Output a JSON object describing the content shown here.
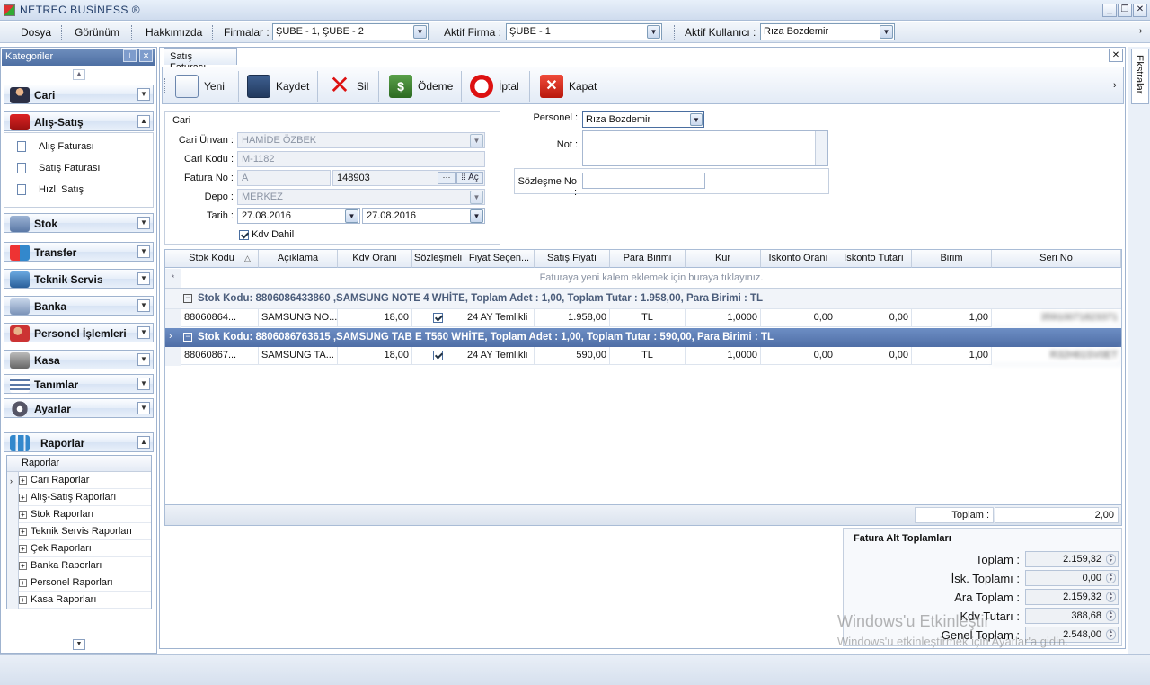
{
  "window": {
    "title": "NETREC BUSİNESS ®"
  },
  "menu": {
    "items": [
      "Dosya",
      "Görünüm",
      "Hakkımızda"
    ],
    "firmalar_label": "Firmalar :",
    "firmalar_value": "ŞUBE - 1, ŞUBE - 2",
    "aktif_firma_label": "Aktif Firma :",
    "aktif_firma_value": "ŞUBE - 1",
    "aktif_kullanici_label": "Aktif Kullanıcı :",
    "aktif_kullanici_value": "Rıza Bozdemir"
  },
  "sidebar": {
    "title": "Kategoriler",
    "groups": [
      "Cari",
      "Alış-Satış",
      "Stok",
      "Transfer",
      "Teknik Servis",
      "Banka",
      "Personel İşlemleri",
      "Kasa",
      "Tanımlar",
      "Ayarlar",
      "Raporlar"
    ],
    "alis_satis_items": [
      "Alış Faturası",
      "Satış Faturası",
      "Hızlı Satış"
    ],
    "raporlar_header": "Raporlar",
    "raporlar_items": [
      "Cari Raporlar",
      "Alış-Satış Raporları",
      "Stok Raporları",
      "Teknik Servis Raporları",
      "Çek Raporları",
      "Banka Raporları",
      "Personel Raporları",
      "Kasa Raporları"
    ]
  },
  "right_strip": {
    "label": "Ekstralar"
  },
  "tab": {
    "label": "Satış Faturası"
  },
  "toolbar": {
    "yeni": "Yeni",
    "kaydet": "Kaydet",
    "sil": "Sil",
    "odeme": "Ödeme",
    "iptal": "İptal",
    "kapat": "Kapat"
  },
  "cari": {
    "group_title": "Cari",
    "unvan_label": "Cari Ünvan :",
    "unvan_value": "HAMİDE ÖZBEK",
    "kod_label": "Cari Kodu :",
    "kod_value": "M-1182",
    "fatura_label": "Fatura No :",
    "fatura_seri": "A",
    "fatura_no": "148903",
    "ac_label": "Aç",
    "depo_label": "Depo :",
    "depo_value": "MERKEZ",
    "tarih_label": "Tarih :",
    "tarih1": "27.08.2016",
    "tarih2": "27.08.2016",
    "kdv_dahil": "Kdv Dahil"
  },
  "personel": {
    "label": "Personel :",
    "value": "Rıza Bozdemir",
    "not_label": "Not :",
    "sozlesme_label": "Sözleşme No :"
  },
  "grid": {
    "columns": [
      "Stok Kodu",
      "Açıklama",
      "Kdv Oranı",
      "Sözleşmeli",
      "Fiyat Seçen...",
      "Satış Fiyatı",
      "Para Birimi",
      "Kur",
      "Iskonto Oranı",
      "Iskonto Tutarı",
      "Birim",
      "Seri No"
    ],
    "new_row_hint": "Faturaya yeni kalem eklemek için buraya tıklayınız.",
    "groups": [
      {
        "header": "Stok Kodu: 8806086433860 ,SAMSUNG NOTE 4 WHİTE, Toplam Adet : 1,00, Toplam Tutar : 1.958,00, Para Birimi : TL",
        "row": {
          "stok_kodu": "88060864...",
          "aciklama": "SAMSUNG NO...",
          "kdv": "18,00",
          "fiyat_secenek": "24 AY Temlikli",
          "satis_fiyati": "1.958,00",
          "para_birimi": "TL",
          "kur": "1,0000",
          "iskonto_orani": "0,00",
          "iskonto_tutari": "0,00",
          "birim": "1,00",
          "seri_no": "35910071823371"
        }
      },
      {
        "header": "Stok Kodu: 8806086763615 ,SAMSUNG TAB E T560 WHİTE, Toplam Adet : 1,00, Toplam Tutar : 590,00, Para Birimi : TL",
        "row": {
          "stok_kodu": "88060867...",
          "aciklama": "SAMSUNG TA...",
          "kdv": "18,00",
          "fiyat_secenek": "24 AY Temlikli",
          "satis_fiyati": "590,00",
          "para_birimi": "TL",
          "kur": "1,0000",
          "iskonto_orani": "0,00",
          "iskonto_tutari": "0,00",
          "birim": "1,00",
          "seri_no": "R32H61SV0ET"
        }
      }
    ],
    "footer_label": "Toplam :",
    "footer_value": "2,00"
  },
  "totals": {
    "title": "Fatura Alt Toplamları",
    "rows": [
      {
        "label": "Toplam :",
        "value": "2.159,32"
      },
      {
        "label": "İsk. Toplamı :",
        "value": "0,00"
      },
      {
        "label": "Ara Toplam :",
        "value": "2.159,32"
      },
      {
        "label": "Kdv Tutarı :",
        "value": "388,68"
      },
      {
        "label": "Genel Toplam :",
        "value": "2.548,00"
      }
    ]
  },
  "watermark": {
    "line1": "Windows'u Etkinleştir",
    "line2": "Windows'u etkinleştirmek için Ayarlar'a gidin."
  }
}
